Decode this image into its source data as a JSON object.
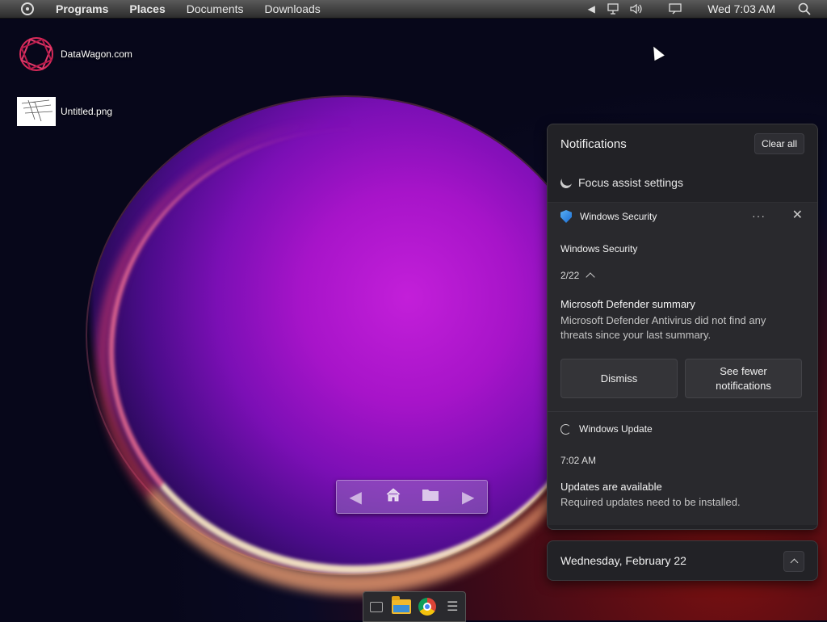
{
  "topbar": {
    "menus": [
      "Programs",
      "Places",
      "Documents",
      "Downloads"
    ],
    "clock": "Wed 7:03 AM",
    "icons": [
      "system-logo-icon",
      "arrow-left-icon",
      "network-icon",
      "volume-icon",
      "display-icon",
      "search-icon"
    ]
  },
  "desktop": {
    "icons": [
      {
        "label": "DataWagon.com",
        "icon": "datawagon-logo-icon"
      },
      {
        "label": "Untitled.png",
        "icon": "image-thumbnail-icon"
      }
    ]
  },
  "dock": {
    "icons": [
      "back-arrow-icon",
      "home-icon",
      "folder-icon",
      "forward-arrow-icon"
    ]
  },
  "taskbar": {
    "icons": [
      "terminal-icon",
      "file-manager-icon",
      "chrome-icon",
      "menu-icon"
    ]
  },
  "notifications": {
    "title": "Notifications",
    "clear_all": "Clear all",
    "focus_assist": "Focus assist settings",
    "security": {
      "source": "Windows Security",
      "app_name": "Windows Security",
      "count": "2/22",
      "title": "Microsoft Defender summary",
      "body": "Microsoft Defender Antivirus did not find any threats since your last summary.",
      "more": "···",
      "close": "✕",
      "dismiss": "Dismiss",
      "see_fewer": "See fewer notifications"
    },
    "update": {
      "source": "Windows Update",
      "time": "7:02 AM",
      "title": "Updates are available",
      "body": "Required updates need to be installed."
    }
  },
  "calendar": {
    "date": "Wednesday, February 22"
  },
  "colors": {
    "panel_bg": "#222226",
    "card_bg": "#29292d",
    "shield_blue": "#1b6dd2"
  }
}
